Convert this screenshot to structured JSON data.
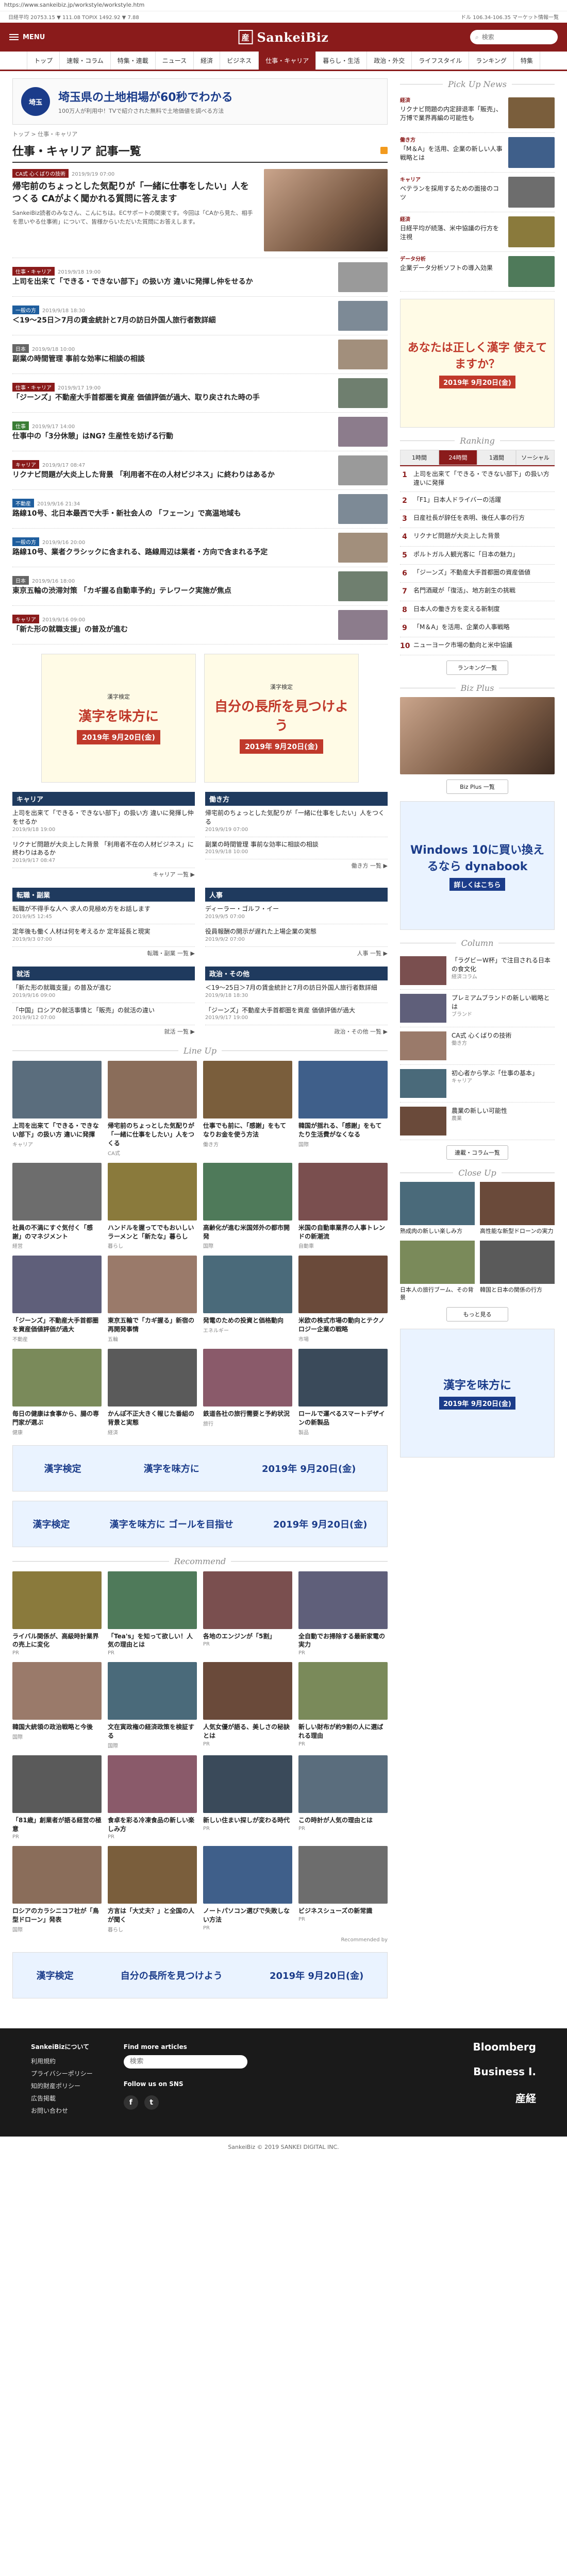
{
  "browser": {
    "url": "https://www.sankeibiz.jp/workstyle/workstyle.htm"
  },
  "ticker": {
    "left": "日経平均  20753.15  ▼ 111.08   TOPIX  1492.92  ▼ 7.88",
    "right": "ドル 106.34-106.35   マーケット情報一覧"
  },
  "header": {
    "menu_label": "MENU",
    "logo_mark": "産",
    "logo_text": "SankeiBiz",
    "search_placeholder": "検索"
  },
  "nav": [
    "トップ",
    "速報・コラム",
    "特集・連載",
    "ニュース",
    "経済",
    "ビジネス",
    "仕事・キャリア",
    "暮らし・生活",
    "政治・外交",
    "ライフスタイル",
    "ランキング",
    "特集"
  ],
  "nav_active_index": 6,
  "top_ad": {
    "logo": "埼玉",
    "title": "埼玉県の土地相場が60秒でわかる",
    "sub": "100万人が利用中！TVで紹介された無料で土地価値を調べる方法"
  },
  "breadcrumb": "トップ > 仕事・キャリア",
  "page_title": "仕事・キャリア 記事一覧",
  "lead": {
    "badge": "CA式 心くばりの技術",
    "date": "2019/9/19 07:00",
    "title": "帰宅前のちょっとした気配りが「一緒に仕事をしたい」人をつくる CAがよく聞かれる質問に答えます",
    "body": "SankeiBiz読者のみなさん、こんにちは。ECサポートの関東です。今回は「CAから見た、相手を思いやる仕事術」について、皆様からいただいた質問にお答えします。"
  },
  "articles": [
    {
      "badge": "仕事・キャリア",
      "color": "",
      "date": "2019/9/18 19:00",
      "title": "上司を出来て「できる・できない部下」の扱い方 違いに発揮し仲をせるか"
    },
    {
      "badge": "一般の方",
      "color": "blue",
      "date": "2019/9/18 18:30",
      "title": "＜19～25日＞7月の賃金統計と7月の訪日外国人旅行者数詳細"
    },
    {
      "badge": "日本",
      "color": "gray",
      "date": "2019/9/18 10:00",
      "title": "副業の時間管理 事前な効率に相談の相談"
    },
    {
      "badge": "仕事・キャリア",
      "color": "",
      "date": "2019/9/17 19:00",
      "title": "「ジーンズ」不動産大手首都圏を資産 価値評価が過大、取り戻された時の手"
    },
    {
      "badge": "仕事",
      "color": "green",
      "date": "2019/9/17 14:00",
      "title": "仕事中の「3分休憩」はNG? 生産性を妨げる行動"
    },
    {
      "badge": "キャリア",
      "color": "",
      "date": "2019/9/17 08:47",
      "title": "リクナビ問題が大炎上した背景 「利用者不在の人材ビジネス」に終わりはあるか"
    },
    {
      "badge": "不動産",
      "color": "blue",
      "date": "2019/9/16 21:34",
      "title": "路線10号、北日本最西で大手・新社会人の 「フェーン」で高温地域も"
    },
    {
      "badge": "一般の方",
      "color": "blue",
      "date": "2019/9/16 20:00",
      "title": "路線10号、業者クラシックに含まれる、路線周辺は業者・方向で含まれる予定"
    },
    {
      "badge": "日本",
      "color": "gray",
      "date": "2019/9/16 18:00",
      "title": "東京五輪の渋滞対策 「カギ握る自動車予約」テレワーク実施が焦点"
    },
    {
      "badge": "キャリア",
      "color": "",
      "date": "2019/9/16 09:00",
      "title": "「新た形の就職支援」の普及が進む"
    }
  ],
  "promos": [
    {
      "tag": "漢字検定",
      "title": "漢字を味方に",
      "date": "2019年 9月20日(金)"
    },
    {
      "tag": "漢字検定",
      "title": "自分の長所を見つけよう",
      "date": "2019年 9月20日(金)"
    }
  ],
  "cat_blocks": [
    {
      "head": "キャリア",
      "items": [
        {
          "t": "上司を出来て「できる・できない部下」の扱い方 違いに発揮し仲をせるか",
          "d": "2019/9/18 19:00"
        },
        {
          "t": "リクナビ問題が大炎上した背景 「利用者不在の人材ビジネス」に終わりはあるか",
          "d": "2019/9/17 08:47"
        }
      ],
      "more": "キャリア 一覧 ▶"
    },
    {
      "head": "働き方",
      "items": [
        {
          "t": "帰宅前のちょっとした気配りが「一緒に仕事をしたい」人をつくる",
          "d": "2019/9/19 07:00"
        },
        {
          "t": "副業の時間管理 事前な効率に相談の相談",
          "d": "2019/9/18 10:00"
        }
      ],
      "more": "働き方 一覧 ▶"
    },
    {
      "head": "転職・副業",
      "items": [
        {
          "t": "転職が不得手な人へ 求人の見極め方をお話します",
          "d": "2019/9/5 12:45"
        },
        {
          "t": "定年後も働く人材は何を考えるか 定年延長と現実",
          "d": "2019/9/3 07:00"
        }
      ],
      "more": "転職・副業 一覧 ▶"
    },
    {
      "head": "人事",
      "items": [
        {
          "t": "ディーラー・ゴルフ・イー",
          "d": "2019/9/5 07:00"
        },
        {
          "t": "役員報酬の開示が遅れた上場企業の実態",
          "d": "2019/9/2 07:00"
        }
      ],
      "more": "人事 一覧 ▶"
    },
    {
      "head": "就活",
      "items": [
        {
          "t": "「新た形の就職支援」の普及が進む",
          "d": "2019/9/16 09:00"
        },
        {
          "t": "「中国」ロシアの就活事情と「販売」の就活の違い",
          "d": "2019/9/12 07:00"
        }
      ],
      "more": "就活 一覧 ▶"
    },
    {
      "head": "政治・その他",
      "items": [
        {
          "t": "＜19～25日＞7月の賃金統計と7月の訪日外国人旅行者数詳細",
          "d": "2019/9/18 18:30"
        },
        {
          "t": "「ジーンズ」不動産大手首都圏を資産 価値評価が過大",
          "d": "2019/9/17 19:00"
        }
      ],
      "more": "政治・その他 一覧 ▶"
    }
  ],
  "lineup_head": "Line Up",
  "lineup": [
    {
      "t": "上司を出来て「できる・できない部下」の扱い方 違いに発揮",
      "s": "キャリア"
    },
    {
      "t": "帰宅前のちょっとした気配りが「一緒に仕事をしたい」人をつくる",
      "s": "CA式"
    },
    {
      "t": "仕事でも前に、「感謝」をもてなりお金を使う方法",
      "s": "働き方"
    },
    {
      "t": "韓国が揺れる、「感謝」をもてたり生活費がなくなる",
      "s": "国際"
    },
    {
      "t": "社員の不満にすぐ気付く「感謝」のマネジメント",
      "s": "経営"
    },
    {
      "t": "ハンドルを握ってでもおいしいラーメンと「新たな」暮らし",
      "s": "暮らし"
    },
    {
      "t": "高齢化が進む米国郊外の都市開発",
      "s": "国際"
    },
    {
      "t": "米国の自動車業界の人事トレンドの新潮流",
      "s": "自動車"
    },
    {
      "t": "「ジーンズ」不動産大手首都圏を資産価値評価が過大",
      "s": "不動産"
    },
    {
      "t": "東京五輪で「カギ握る」新宿の再開発事情",
      "s": "五輪"
    },
    {
      "t": "発電のための投資と価格動向",
      "s": "エネルギー"
    },
    {
      "t": "米欧の株式市場の動向とテクノロジー企業の戦略",
      "s": "市場"
    },
    {
      "t": "毎日の健康は食事から、腸の専門家が選ぶ",
      "s": "健康"
    },
    {
      "t": "かんぽ不正大きく報じた番組の背景と実態",
      "s": "経済"
    },
    {
      "t": "鉄道各社の旅行需要と予約状況",
      "s": "旅行"
    },
    {
      "t": "ロールで運べるスマートデザインの新製品",
      "s": "製品"
    }
  ],
  "wide_promo": {
    "left": "漢字検定",
    "mid": "漢字を味方に",
    "right": "2019年 9月20日(金)"
  },
  "wide_promo2": {
    "left": "漢字検定",
    "mid": "漢字を味方に ゴールを目指せ",
    "right": "2019年 9月20日(金)"
  },
  "rec_head": "Recommend",
  "recommend": [
    {
      "t": "ライバル関係が、高級時計業界の売上に変化",
      "s": "PR"
    },
    {
      "t": "「Tea's」を知って欲しい！人気の理由とは",
      "s": "PR"
    },
    {
      "t": "各地のエンジンが「5割」",
      "s": "PR"
    },
    {
      "t": "全自動でお掃除する最新家電の実力",
      "s": "PR"
    },
    {
      "t": "韓国大統領の政治戦略と今後",
      "s": "国際"
    },
    {
      "t": "文在寅政権の経済政策を検証する",
      "s": "国際"
    },
    {
      "t": "人気女優が語る、美しさの秘訣とは",
      "s": "PR"
    },
    {
      "t": "新しい財布が約9割の人に選ばれる理由",
      "s": "PR"
    },
    {
      "t": "「81歳」創業者が語る経営の極意",
      "s": "PR"
    },
    {
      "t": "食卓を彩る冷凍食品の新しい楽しみ方",
      "s": "PR"
    },
    {
      "t": "新しい住まい探しが変わる時代",
      "s": "PR"
    },
    {
      "t": "この時計が人気の理由とは",
      "s": "PR"
    },
    {
      "t": "ロシアのカラシニコフ社が「鳥型ドローン」発表",
      "s": "国際"
    },
    {
      "t": "方言は「大丈夫？」と全国の人が聞く",
      "s": "暮らし"
    },
    {
      "t": "ノートパソコン選びで失敗しない方法",
      "s": "PR"
    },
    {
      "t": "ビジネスシューズの新常識",
      "s": "PR"
    }
  ],
  "rec_credit": "Recommended by",
  "bottom_promo": {
    "left": "漢字検定",
    "mid": "自分の長所を見つけよう",
    "right": "2019年 9月20日(金)"
  },
  "side": {
    "pickup_head": "Pick Up News",
    "pickup": [
      {
        "cat": "経済",
        "t": "リクナビ問題の内定辞退率「販売」、万博で業界再編の可能性も"
      },
      {
        "cat": "働き方",
        "t": "「M＆A」を活用、企業の新しい人事戦略とは"
      },
      {
        "cat": "キャリア",
        "t": "ベテランを採用するための面接のコツ"
      },
      {
        "cat": "経済",
        "t": "日経平均が続落、米中協議の行方を注視"
      },
      {
        "cat": "データ分析",
        "t": "企業データ分析ソフトの導入効果"
      }
    ],
    "ad1": {
      "a1": "あなたは正しく漢字 使えてますか？",
      "a2": "2019年 9月20日(金)"
    },
    "rank_head": "Ranking",
    "rank_tabs": [
      "1時間",
      "24時間",
      "1週間",
      "ソーシャル"
    ],
    "rank_active": 1,
    "ranking": [
      "上司を出来て「できる・できない部下」の扱い方 違いに発揮",
      "「F1」日本人ドライバーの活躍",
      "日産社長が辞任を表明、後任人事の行方",
      "リクナビ問題が大炎上した背景",
      "ポルトガル人観光客に「日本の魅力」",
      "「ジーンズ」不動産大手首都圏の資産価値",
      "名門酒蔵が「復活」、地方創生の挑戦",
      "日本人の働き方を変える新制度",
      "「M＆A」を活用、企業の人事戦略",
      "ニューヨーク市場の動向と米中協議"
    ],
    "rank_more": "ランキング一覧",
    "bizplus_head": "Biz Plus",
    "bizplus_more": "Biz Plus 一覧",
    "ad2": {
      "a1": "Windows 10に買い換えるなら dynabook",
      "a2": "詳しくはこちら"
    },
    "column_head": "Column",
    "columns": [
      {
        "t": "「ラグビーW杯」で注目される日本の食文化",
        "by": "経済コラム"
      },
      {
        "t": "プレミアムブランドの新しい戦略とは",
        "by": "ブランド"
      },
      {
        "t": "CA式 心くばりの技術",
        "by": "働き方"
      },
      {
        "t": "初心者から学ぶ「仕事の基本」",
        "by": "キャリア"
      },
      {
        "t": "農業の新しい可能性",
        "by": "農業"
      }
    ],
    "column_more": "連載・コラム一覧",
    "close_head": "Close Up",
    "closeups": [
      {
        "t": "熟成肉の新しい楽しみ方"
      },
      {
        "t": "高性能な新型ドローンの実力"
      },
      {
        "t": "日本人の旅行ブーム、その背景"
      },
      {
        "t": "韓国と日本の関係の行方"
      }
    ],
    "close_more": "もっと見る",
    "ad3": {
      "a1": "漢字を味方に",
      "a2": "2019年 9月20日(金)"
    }
  },
  "footer": {
    "left_head": "SankeiBizについて",
    "left_links": [
      "利用規約",
      "プライバシーポリシー",
      "知的財産ポリシー",
      "広告掲載",
      "お問い合わせ"
    ],
    "mid_head": "Find more articles",
    "search_placeholder": "検索",
    "social_head": "Follow us on SNS",
    "partners": [
      "Bloomberg",
      "Business I.",
      "産経"
    ],
    "copyright": "SankeiBiz © 2019 SANKEI DIGITAL INC."
  }
}
